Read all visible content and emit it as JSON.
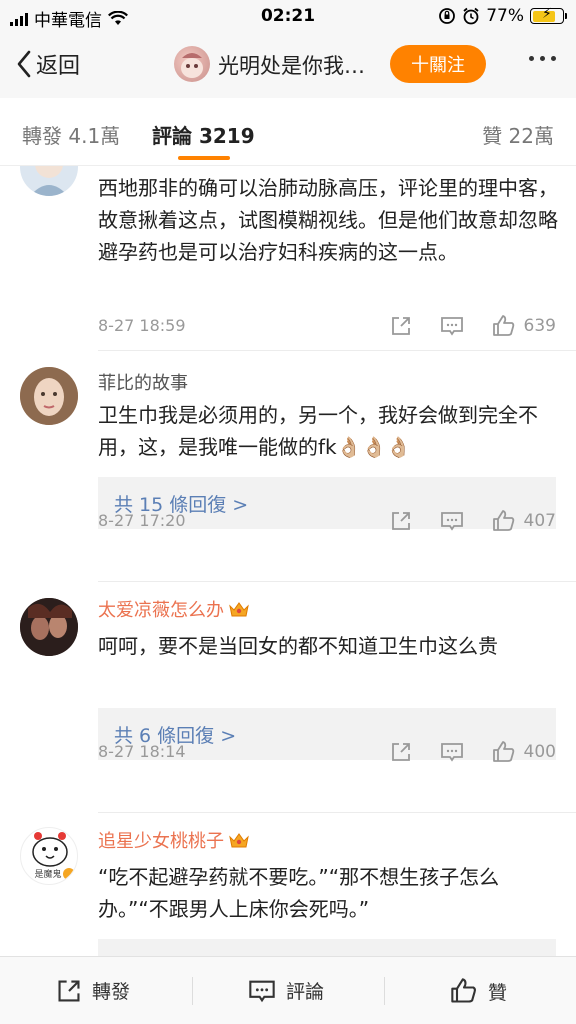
{
  "status_bar": {
    "carrier": "中華電信",
    "time": "02:21",
    "battery": "77%",
    "battery_level": 0.77
  },
  "nav": {
    "back_label": "返回",
    "title": "光明处是你我…",
    "follow_label": "十關注"
  },
  "tabs": {
    "repost": "轉發 4.1萬",
    "comments": "評論 3219",
    "likes": "贊 22萬"
  },
  "comments": [
    {
      "name": "",
      "text": "西地那非的确可以治肺动脉高压，评论里的理中客，故意揪着这点，试图模糊视线。但是他们故意却忽略避孕药也是可以治疗妇科疾病的这一点。",
      "time": "8-27 18:59",
      "likes": "639"
    },
    {
      "name": "菲比的故事",
      "text": "卫生巾我是必须用的，另一个，我好会做到完全不用，这，是我唯一能做的fk👌🏼👌🏼👌🏼",
      "replies": "共 15 條回復 >",
      "time": "8-27 17:20",
      "likes": "407"
    },
    {
      "name": "太爱凉薇怎么办",
      "text": "呵呵，要不是当回女的都不知道卫生巾这么贵",
      "replies": "共 6 條回復 >",
      "time": "8-27 18:14",
      "likes": "400"
    },
    {
      "name": "追星少女桃桃子",
      "text": "“吃不起避孕药就不要吃。”“那不想生孩子怎么办。”“不跟男人上床你会死吗。”",
      "avatar_text": "是魔鬼"
    }
  ],
  "bottom_bar": {
    "repost": "轉發",
    "comment": "評論",
    "like": "贊"
  },
  "colors": {
    "accent": "#ff8200",
    "vip_name": "#eb7350",
    "link": "#5b7fb5"
  }
}
